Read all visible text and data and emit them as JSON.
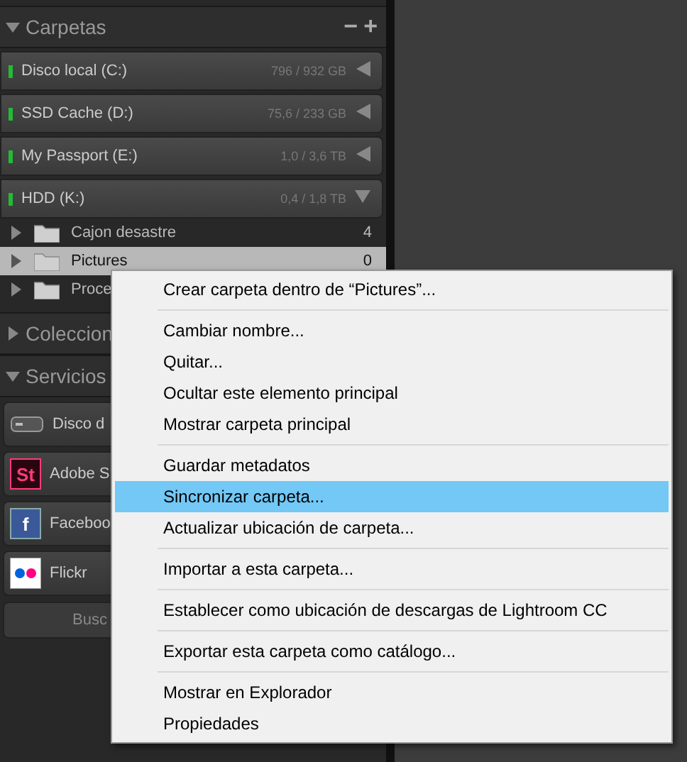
{
  "folders_panel": {
    "title": "Carpetas",
    "expanded": true,
    "minus": "−",
    "plus": "+",
    "volumes": [
      {
        "name": "Disco local (C:)",
        "usage": "796 / 932 GB",
        "color": "#22bb33",
        "expanded": false
      },
      {
        "name": "SSD Cache (D:)",
        "usage": "75,6 / 233 GB",
        "color": "#22bb33",
        "expanded": false
      },
      {
        "name": "My Passport (E:)",
        "usage": "1,0 / 3,6 TB",
        "color": "#22bb33",
        "expanded": false
      },
      {
        "name": "HDD (K:)",
        "usage": "0,4 / 1,8 TB",
        "color": "#22bb33",
        "expanded": true
      }
    ],
    "folders": [
      {
        "name": "Cajon desastre",
        "count": "4",
        "selected": false
      },
      {
        "name": "Pictures",
        "count": "0",
        "selected": true
      },
      {
        "name": "Proce",
        "selected": false
      }
    ]
  },
  "collections_panel": {
    "title": "Coleccion",
    "expanded": false
  },
  "services_panel": {
    "title": "Servicios",
    "expanded": true,
    "services": [
      {
        "kind": "disk",
        "name": "Disco d"
      },
      {
        "kind": "stock",
        "name": "Adobe S",
        "logo": "St"
      },
      {
        "kind": "facebook",
        "name": "Faceboo",
        "logo": "f"
      },
      {
        "kind": "flickr",
        "name": "Flickr"
      }
    ],
    "search_button": "Busc"
  },
  "context_menu": {
    "groups": [
      [
        {
          "label": "Crear carpeta dentro de “Pictures”...",
          "selected": false
        }
      ],
      [
        {
          "label": "Cambiar nombre...",
          "selected": false
        },
        {
          "label": "Quitar...",
          "selected": false
        },
        {
          "label": "Ocultar este elemento principal",
          "selected": false
        },
        {
          "label": "Mostrar carpeta principal",
          "selected": false
        }
      ],
      [
        {
          "label": "Guardar metadatos",
          "selected": false
        },
        {
          "label": "Sincronizar carpeta...",
          "selected": true
        },
        {
          "label": "Actualizar ubicación de carpeta...",
          "selected": false
        }
      ],
      [
        {
          "label": "Importar a esta carpeta...",
          "selected": false
        }
      ],
      [
        {
          "label": "Establecer como ubicación de descargas de Lightroom CC",
          "selected": false
        }
      ],
      [
        {
          "label": "Exportar esta carpeta como catálogo...",
          "selected": false
        }
      ],
      [
        {
          "label": "Mostrar en Explorador",
          "selected": false
        },
        {
          "label": "Propiedades",
          "selected": false
        }
      ]
    ]
  }
}
